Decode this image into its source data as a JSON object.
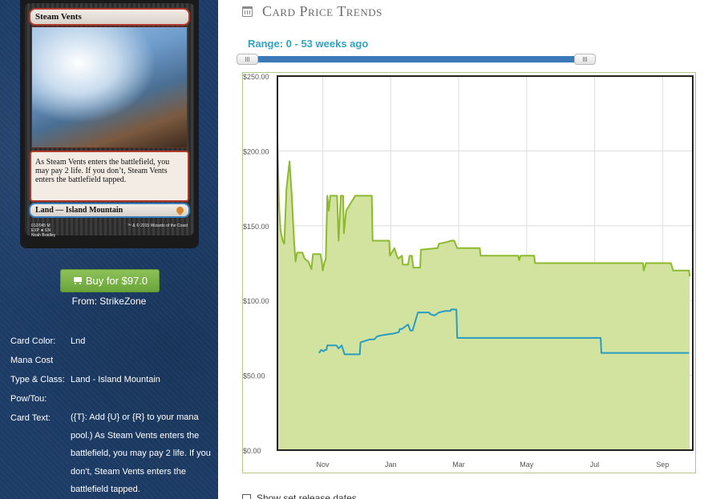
{
  "card": {
    "name": "Steam Vents",
    "rules_text": "As Steam Vents enters the battlefield, you may pay 2 life. If you don’t, Steam Vents enters the battlefield tapped.",
    "type_line": "Land — Island Mountain",
    "collector": "012/045 M",
    "set_line": "EXP ★ EN",
    "artist": "Noah Bradley",
    "copyright": "™ & © 2015 Wizards of the Coast"
  },
  "purchase": {
    "button_label": "Buy for $97.0",
    "vendor_text": "From: StrikeZone"
  },
  "details": [
    {
      "label": "Card Color:",
      "value": "Lnd"
    },
    {
      "label": "Mana Cost",
      "value": ""
    },
    {
      "label": "Type & Class:",
      "value": "Land - Island Mountain"
    },
    {
      "label": "Pow/Tou:",
      "value": ""
    },
    {
      "label": "Card Text:",
      "value": "({T}: Add {U} or {R} to your mana pool.) As Steam Vents enters the battlefield, you may pay 2 life. If you don't, Steam Vents enters the battlefield tapped."
    }
  ],
  "trends": {
    "title": "Card Price Trends",
    "icon": "calendar-icon",
    "range_label": "Range: 0 - 53 weeks ago",
    "checkbox_label": "Show set release dates"
  },
  "chart_data": {
    "type": "line",
    "x_tick_labels": [
      "Nov",
      "Jan",
      "Mar",
      "May",
      "Jul",
      "Sep"
    ],
    "x_tick_weeks": [
      6,
      15,
      24,
      33,
      42,
      51
    ],
    "xlim": [
      0,
      55
    ],
    "y_tick_labels": [
      "$250.00",
      "$200.00",
      "$150.00",
      "$100.00",
      "$50.00",
      "$0.00"
    ],
    "ylim": [
      0,
      250
    ],
    "grid": true,
    "colors": {
      "area_fill": "#d2e3a0",
      "area_line": "#8db92e",
      "series_line": "#2a9cc0",
      "plot_border": "#222222",
      "outer_border": "#b3c98a"
    },
    "series": [
      {
        "kind": "area",
        "points": [
          [
            0,
            208
          ],
          [
            0.2,
            165
          ],
          [
            0.4,
            147
          ],
          [
            0.7,
            140
          ],
          [
            0.9,
            138
          ],
          [
            1.2,
            175
          ],
          [
            1.6,
            193
          ],
          [
            1.9,
            170
          ],
          [
            2.2,
            140
          ],
          [
            2.4,
            126
          ],
          [
            2.6,
            132
          ],
          [
            3.3,
            132
          ],
          [
            3.6,
            128
          ],
          [
            4.1,
            126
          ],
          [
            4.5,
            121
          ],
          [
            4.7,
            131
          ],
          [
            5.7,
            131
          ],
          [
            5.9,
            125
          ],
          [
            6,
            120
          ],
          [
            6.2,
            125
          ],
          [
            6.4,
            128
          ],
          [
            6.6,
            170
          ],
          [
            6.8,
            160
          ],
          [
            7,
            170
          ],
          [
            7.9,
            170
          ],
          [
            8.1,
            140
          ],
          [
            8.4,
            170
          ],
          [
            8.7,
            170
          ],
          [
            8.8,
            145
          ],
          [
            9.1,
            160
          ],
          [
            10.3,
            170
          ],
          [
            11.5,
            170
          ],
          [
            12.5,
            170
          ],
          [
            12.6,
            140
          ],
          [
            14.8,
            140
          ],
          [
            14.9,
            130
          ],
          [
            15.5,
            135
          ],
          [
            15.8,
            130
          ],
          [
            16,
            128
          ],
          [
            16.5,
            130
          ],
          [
            16.6,
            124
          ],
          [
            17.3,
            124
          ],
          [
            17.5,
            130
          ],
          [
            17.8,
            130
          ],
          [
            18,
            122
          ],
          [
            18.9,
            122
          ],
          [
            19,
            134
          ],
          [
            21.2,
            135
          ],
          [
            21.4,
            138
          ],
          [
            22.4,
            139
          ],
          [
            23,
            140
          ],
          [
            23.4,
            140
          ],
          [
            23.8,
            135
          ],
          [
            26.8,
            135
          ],
          [
            26.9,
            130
          ],
          [
            28.5,
            130
          ],
          [
            31.9,
            130
          ],
          [
            32,
            127
          ],
          [
            32.2,
            130
          ],
          [
            34,
            130
          ],
          [
            34.1,
            125
          ],
          [
            42.3,
            125
          ],
          [
            48.4,
            125
          ],
          [
            48.5,
            120
          ],
          [
            48.8,
            125
          ],
          [
            52.1,
            125
          ],
          [
            52.4,
            120
          ],
          [
            54.5,
            120
          ],
          [
            54.6,
            116
          ]
        ]
      },
      {
        "kind": "line",
        "points": [
          [
            5.5,
            65
          ],
          [
            5.8,
            67
          ],
          [
            6.1,
            66
          ],
          [
            6.3,
            67
          ],
          [
            6.5,
            67
          ],
          [
            6.6,
            70
          ],
          [
            7.8,
            70
          ],
          [
            8.1,
            68
          ],
          [
            8.5,
            70
          ],
          [
            8.9,
            64
          ],
          [
            10.9,
            64
          ],
          [
            11,
            72
          ],
          [
            12.2,
            74
          ],
          [
            12.8,
            74
          ],
          [
            13.2,
            76
          ],
          [
            14,
            77
          ],
          [
            15.5,
            78
          ],
          [
            16.1,
            79
          ],
          [
            16.2,
            81
          ],
          [
            16.5,
            81
          ],
          [
            17.3,
            84
          ],
          [
            17.6,
            80
          ],
          [
            17.9,
            80
          ],
          [
            18.3,
            87
          ],
          [
            18.6,
            92
          ],
          [
            20.1,
            92
          ],
          [
            20.2,
            91
          ],
          [
            20.8,
            90
          ],
          [
            21.4,
            92
          ],
          [
            22.2,
            93
          ],
          [
            22.9,
            93
          ],
          [
            23,
            94
          ],
          [
            23.7,
            94
          ],
          [
            23.8,
            75
          ],
          [
            42.8,
            75
          ],
          [
            42.9,
            65
          ],
          [
            54.5,
            65
          ]
        ]
      }
    ]
  }
}
